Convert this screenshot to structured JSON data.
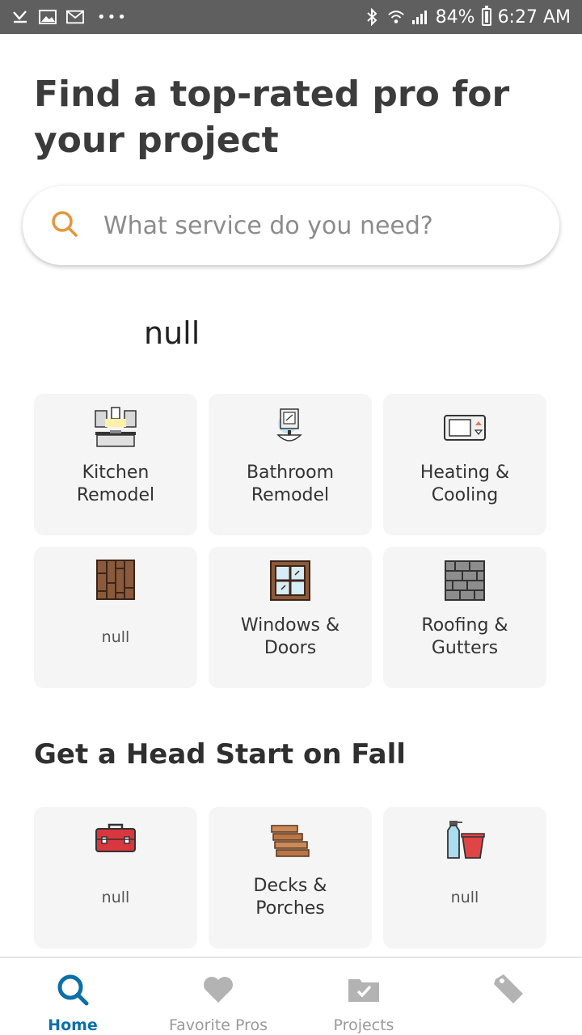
{
  "status_bar": {
    "battery": "84%",
    "time": "6:27 AM",
    "more": "•••"
  },
  "headline": "Find a top-rated pro for your project",
  "search": {
    "placeholder": "What service do you need?"
  },
  "section_title": "null",
  "popular_tiles": [
    {
      "label": "Kitchen Remodel",
      "icon": "kitchen-icon"
    },
    {
      "label": "Bathroom Remodel",
      "icon": "bathroom-icon"
    },
    {
      "label": "Heating & Cooling",
      "icon": "thermostat-icon"
    },
    {
      "label": "null",
      "icon": "wood-floor-icon"
    },
    {
      "label": "Windows & Doors",
      "icon": "window-icon"
    },
    {
      "label": "Roofing & Gutters",
      "icon": "roof-icon"
    }
  ],
  "fall_title": "Get a Head Start on Fall",
  "fall_tiles": [
    {
      "label": "null",
      "icon": "toolbox-icon"
    },
    {
      "label": "Decks & Porches",
      "icon": "deck-icon"
    },
    {
      "label": "null",
      "icon": "cleaning-icon"
    }
  ],
  "nav": [
    {
      "label": "Home",
      "icon": "search-icon",
      "active": true
    },
    {
      "label": "Favorite Pros",
      "icon": "heart-icon"
    },
    {
      "label": "Projects",
      "icon": "folder-check-icon"
    },
    {
      "label": "",
      "icon": "tag-icon"
    }
  ],
  "colors": {
    "accent": "#0b6fa8",
    "search_icon": "#e8953a",
    "tile_bg": "#f5f5f5"
  }
}
